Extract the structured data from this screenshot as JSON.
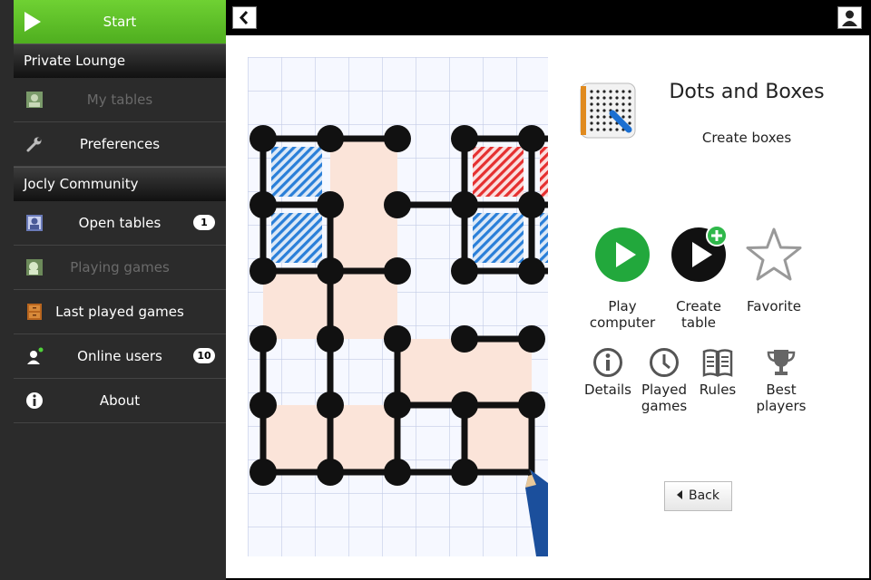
{
  "sidebar": {
    "start_label": "Start",
    "sections": [
      {
        "title": "Private Lounge",
        "items": [
          {
            "label": "My tables",
            "icon": "my-tables-icon",
            "disabled": true
          },
          {
            "label": "Preferences",
            "icon": "wrench-icon",
            "disabled": false
          }
        ]
      },
      {
        "title": "Jocly Community",
        "items": [
          {
            "label": "Open tables",
            "icon": "open-tables-icon",
            "badge": "1",
            "disabled": false
          },
          {
            "label": "Playing games",
            "icon": "playing-games-icon",
            "disabled": true
          },
          {
            "label": "Last played games",
            "icon": "cabinet-icon",
            "disabled": false
          },
          {
            "label": "Online users",
            "icon": "online-user-icon",
            "badge": "10",
            "disabled": false
          },
          {
            "label": "About",
            "icon": "info-icon",
            "disabled": false
          }
        ]
      }
    ]
  },
  "topbar": {
    "back_icon": "chevron-left-icon",
    "user_icon": "user-icon"
  },
  "game": {
    "title": "Dots and Boxes",
    "subtitle": "Create boxes",
    "actions": {
      "play_computer": "Play computer",
      "create_table": "Create table",
      "favorite": "Favorite"
    },
    "links": {
      "details": "Details",
      "played_games": "Played games",
      "rules": "Rules",
      "best_players": "Best players"
    },
    "back_label": "Back"
  },
  "colors": {
    "start_green": "#5cc229",
    "play_green": "#22a83c",
    "blue_box": "#2a7fd8",
    "red_box": "#e53030"
  }
}
